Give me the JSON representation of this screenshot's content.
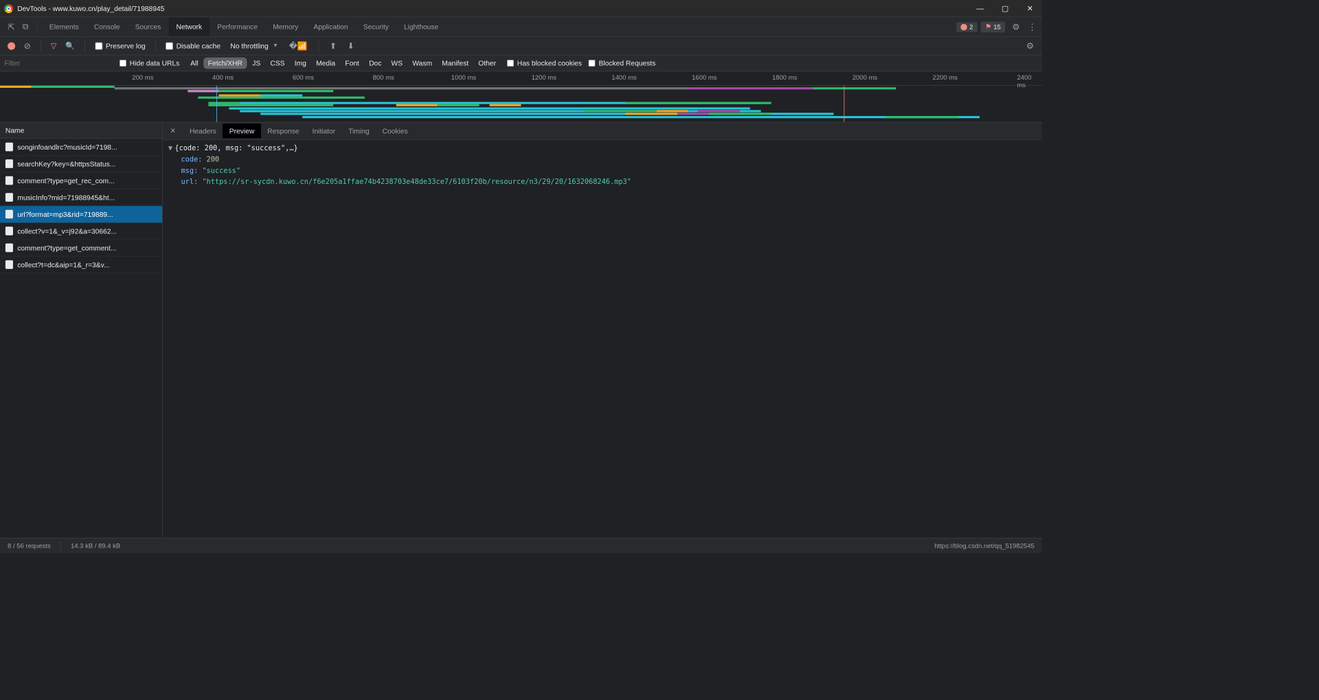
{
  "window": {
    "title": "DevTools - www.kuwo.cn/play_detail/71988945"
  },
  "mainTabs": {
    "items": [
      "Elements",
      "Console",
      "Sources",
      "Network",
      "Performance",
      "Memory",
      "Application",
      "Security",
      "Lighthouse"
    ],
    "active": "Network",
    "errors": "2",
    "warnings": "15"
  },
  "toolbar": {
    "preserveLog": "Preserve log",
    "disableCache": "Disable cache",
    "throttling": "No throttling"
  },
  "filterRow": {
    "placeholder": "Filter",
    "hideData": "Hide data URLs",
    "types": [
      "All",
      "Fetch/XHR",
      "JS",
      "CSS",
      "Img",
      "Media",
      "Font",
      "Doc",
      "WS",
      "Wasm",
      "Manifest",
      "Other"
    ],
    "activeType": "Fetch/XHR",
    "hasBlocked": "Has blocked cookies",
    "blockedReq": "Blocked Requests"
  },
  "timeline": {
    "ticks": [
      "200 ms",
      "400 ms",
      "600 ms",
      "800 ms",
      "1000 ms",
      "1200 ms",
      "1400 ms",
      "1600 ms",
      "1800 ms",
      "2000 ms",
      "2200 ms",
      "2400 ms"
    ]
  },
  "requests": {
    "header": "Name",
    "items": [
      "songinfoandlrc?musicId=7198...",
      "searchKey?key=&httpsStatus...",
      "comment?type=get_rec_com...",
      "musicInfo?mid=71988945&ht...",
      "url?format=mp3&rid=719889...",
      "collect?v=1&_v=j92&a=30662...",
      "comment?type=get_comment...",
      "collect?t=dc&aip=1&_r=3&v..."
    ],
    "selectedIndex": 4
  },
  "detail": {
    "tabs": [
      "Headers",
      "Preview",
      "Response",
      "Initiator",
      "Timing",
      "Cookies"
    ],
    "active": "Preview",
    "preview": {
      "summary": "{code: 200, msg: \"success\",…}",
      "code_key": "code:",
      "code_val": "200",
      "msg_key": "msg:",
      "msg_val": "\"success\"",
      "url_key": "url:",
      "url_val": "\"https://sr-sycdn.kuwo.cn/f6e205a1ffae74b4238703e48de33ce7/6103f20b/resource/n3/29/20/1632068246.mp3\""
    }
  },
  "status": {
    "requests": "8 / 56 requests",
    "transfer": "14.3 kB / 89.4 kB",
    "watermark": "https://blog.csdn.net/qq_51982545"
  }
}
